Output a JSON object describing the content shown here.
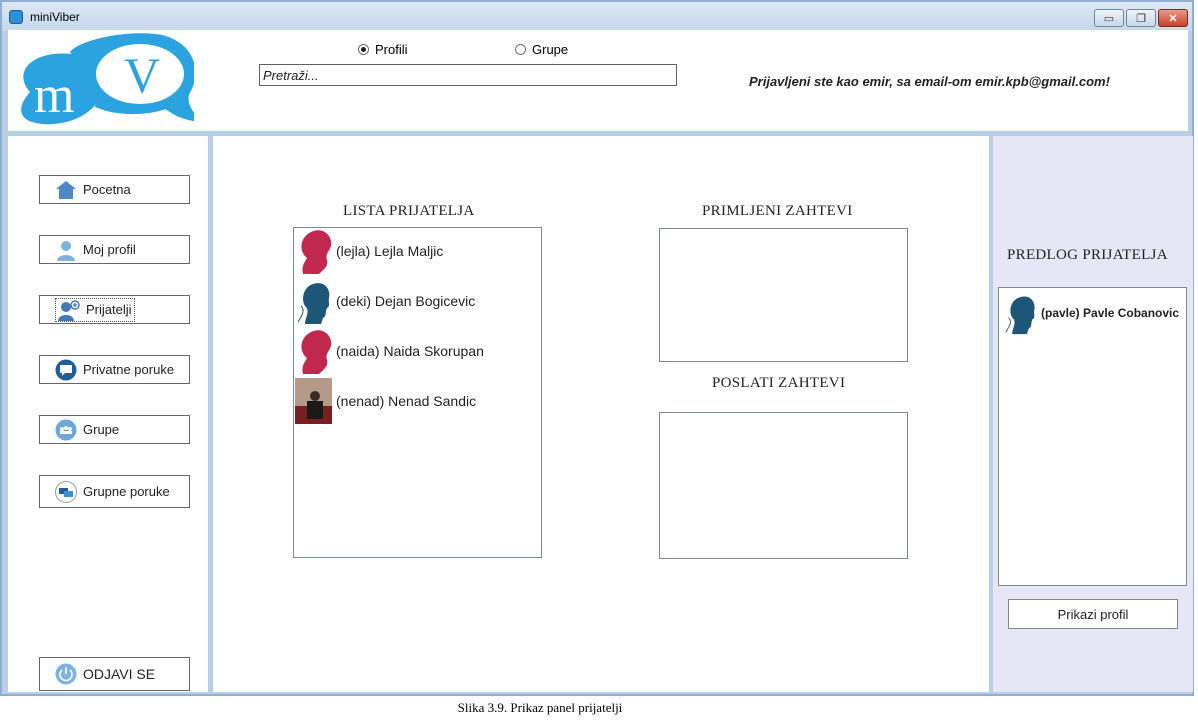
{
  "window": {
    "title": "miniViber"
  },
  "window_controls": {
    "minimize": "▭",
    "maximize": "❐",
    "close": "✕"
  },
  "header": {
    "logo_text": "mV",
    "radio_profiles": {
      "label": "Profili",
      "selected": true
    },
    "radio_groups": {
      "label": "Grupe",
      "selected": false
    },
    "search_placeholder": "Pretraži...",
    "logged_in_text": "Prijavljeni ste kao emir, sa email-om emir.kpb@gmail.com!"
  },
  "sidebar": {
    "items": [
      {
        "label": "Pocetna",
        "icon": "home-icon"
      },
      {
        "label": "Moj profil",
        "icon": "user-icon"
      },
      {
        "label": "Prijatelji",
        "icon": "friends-icon"
      },
      {
        "label": "Privatne poruke",
        "icon": "chat-icon"
      },
      {
        "label": "Grupe",
        "icon": "group-icon"
      },
      {
        "label": "Grupne poruke",
        "icon": "group-messages-icon"
      }
    ],
    "logout_label": "ODJAVI SE"
  },
  "main": {
    "friends_title": "LISTA PRIJATELJA",
    "friends": [
      {
        "label": "(lejla) Lejla Maljic",
        "avatar": "female-silhouette"
      },
      {
        "label": "(deki) Dejan Bogicevic",
        "avatar": "male-silhouette"
      },
      {
        "label": "(naida) Naida Skorupan",
        "avatar": "female-silhouette"
      },
      {
        "label": "(nenad) Nenad Sandic",
        "avatar": "photo"
      }
    ],
    "received_title": "PRIMLJENI ZAHTEVI",
    "sent_title": "POSLATI ZAHTEVI"
  },
  "right_panel": {
    "title": "PREDLOG PRIJATELJA",
    "suggestions": [
      {
        "label": "(pavle) Pavle Cobanovic",
        "avatar": "male-silhouette"
      }
    ],
    "show_profile_label": "Prikazi profil"
  },
  "colors": {
    "female_avatar": "#c0284e",
    "male_avatar": "#1d5678",
    "accent": "#2a8fd6",
    "right_panel_bg": "#e6e6f7"
  },
  "caption": "Slika 3.9. Prikaz panel prijatelji"
}
